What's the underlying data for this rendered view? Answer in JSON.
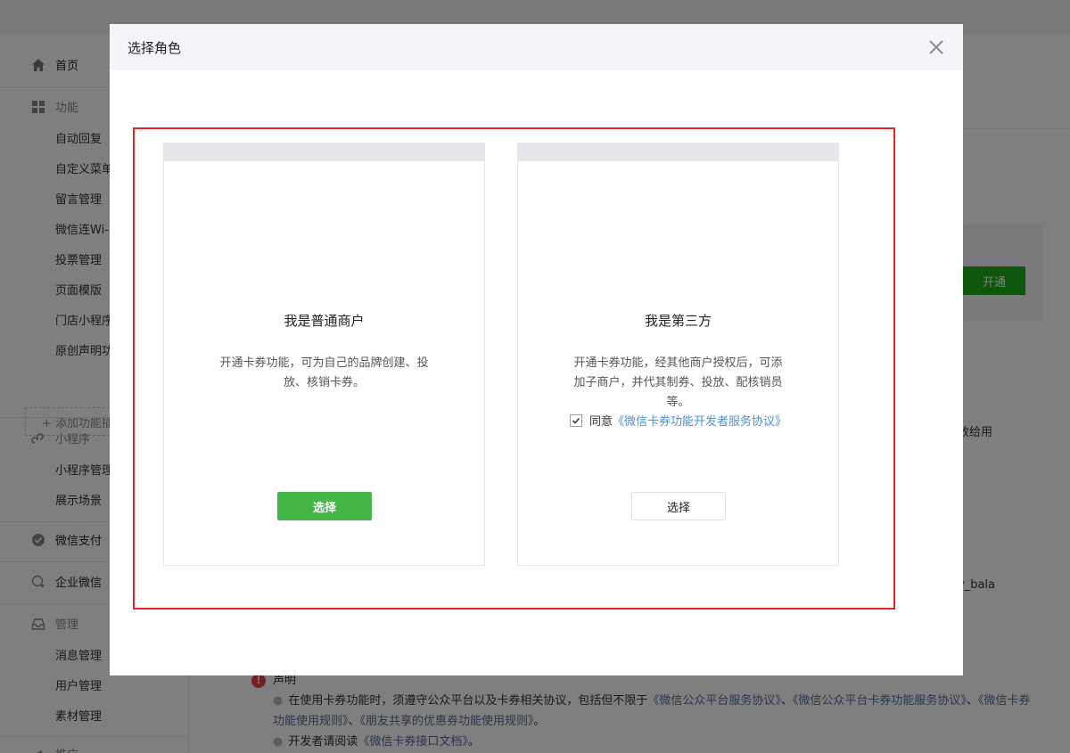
{
  "sidebar": {
    "home": "首页",
    "functions_group": "功能",
    "functions": [
      "自动回复",
      "自定义菜单",
      "留言管理",
      "微信连Wi-Fi",
      "投票管理",
      "页面模版",
      "门店小程序",
      "原创声明功能"
    ],
    "add_function": "+ 添加功能插件",
    "mini_program_group": "小程序",
    "mini_program_items": [
      "小程序管理",
      "展示场景"
    ],
    "wechat_pay": "微信支付",
    "wecom": "企业微信",
    "manage_group": "管理",
    "manage_items": [
      "消息管理",
      "用户管理",
      "素材管理"
    ],
    "last_group": "推广"
  },
  "background": {
    "green_button": "开通",
    "right_text_1": "放给用",
    "right_text_2": "y_bala"
  },
  "notice": {
    "title": "声明",
    "line1_prefix": "在使用卡券功能时，须遵守公众平台以及卡券相关协议，包括但不限于",
    "line1_link1": "《微信公众平台服务协议》",
    "line1_sep1": "、",
    "line1_link2": "《微信公众平台卡券功能服务协议》",
    "line1_sep2": "、",
    "line1_link3": "《微信卡券功能使用规则》",
    "line1_sep3": "、",
    "line1_link4": "《朋友共享的优惠券功能使用规则》",
    "line1_end": "。",
    "line2_prefix": "开发者请阅读",
    "line2_link": "《微信卡券接口文档》",
    "line2_end": "。"
  },
  "dialog": {
    "title": "选择角色",
    "merchant": {
      "title": "我是普通商户",
      "desc": "开通卡券功能，可为自己的品牌创建、投放、核销卡券。",
      "button": "选择"
    },
    "third_party": {
      "title": "我是第三方",
      "desc": "开通卡券功能，经其他商户授权后，可添加子商户，并代其制券、投放、配核销员等。",
      "agree_prefix": "同意",
      "agree_link": "《微信卡券功能开发者服务协议》",
      "button": "选择"
    }
  },
  "colors": {
    "primary_green": "#44b549",
    "link_blue": "#576b95",
    "annotation_red": "#e5252a"
  }
}
